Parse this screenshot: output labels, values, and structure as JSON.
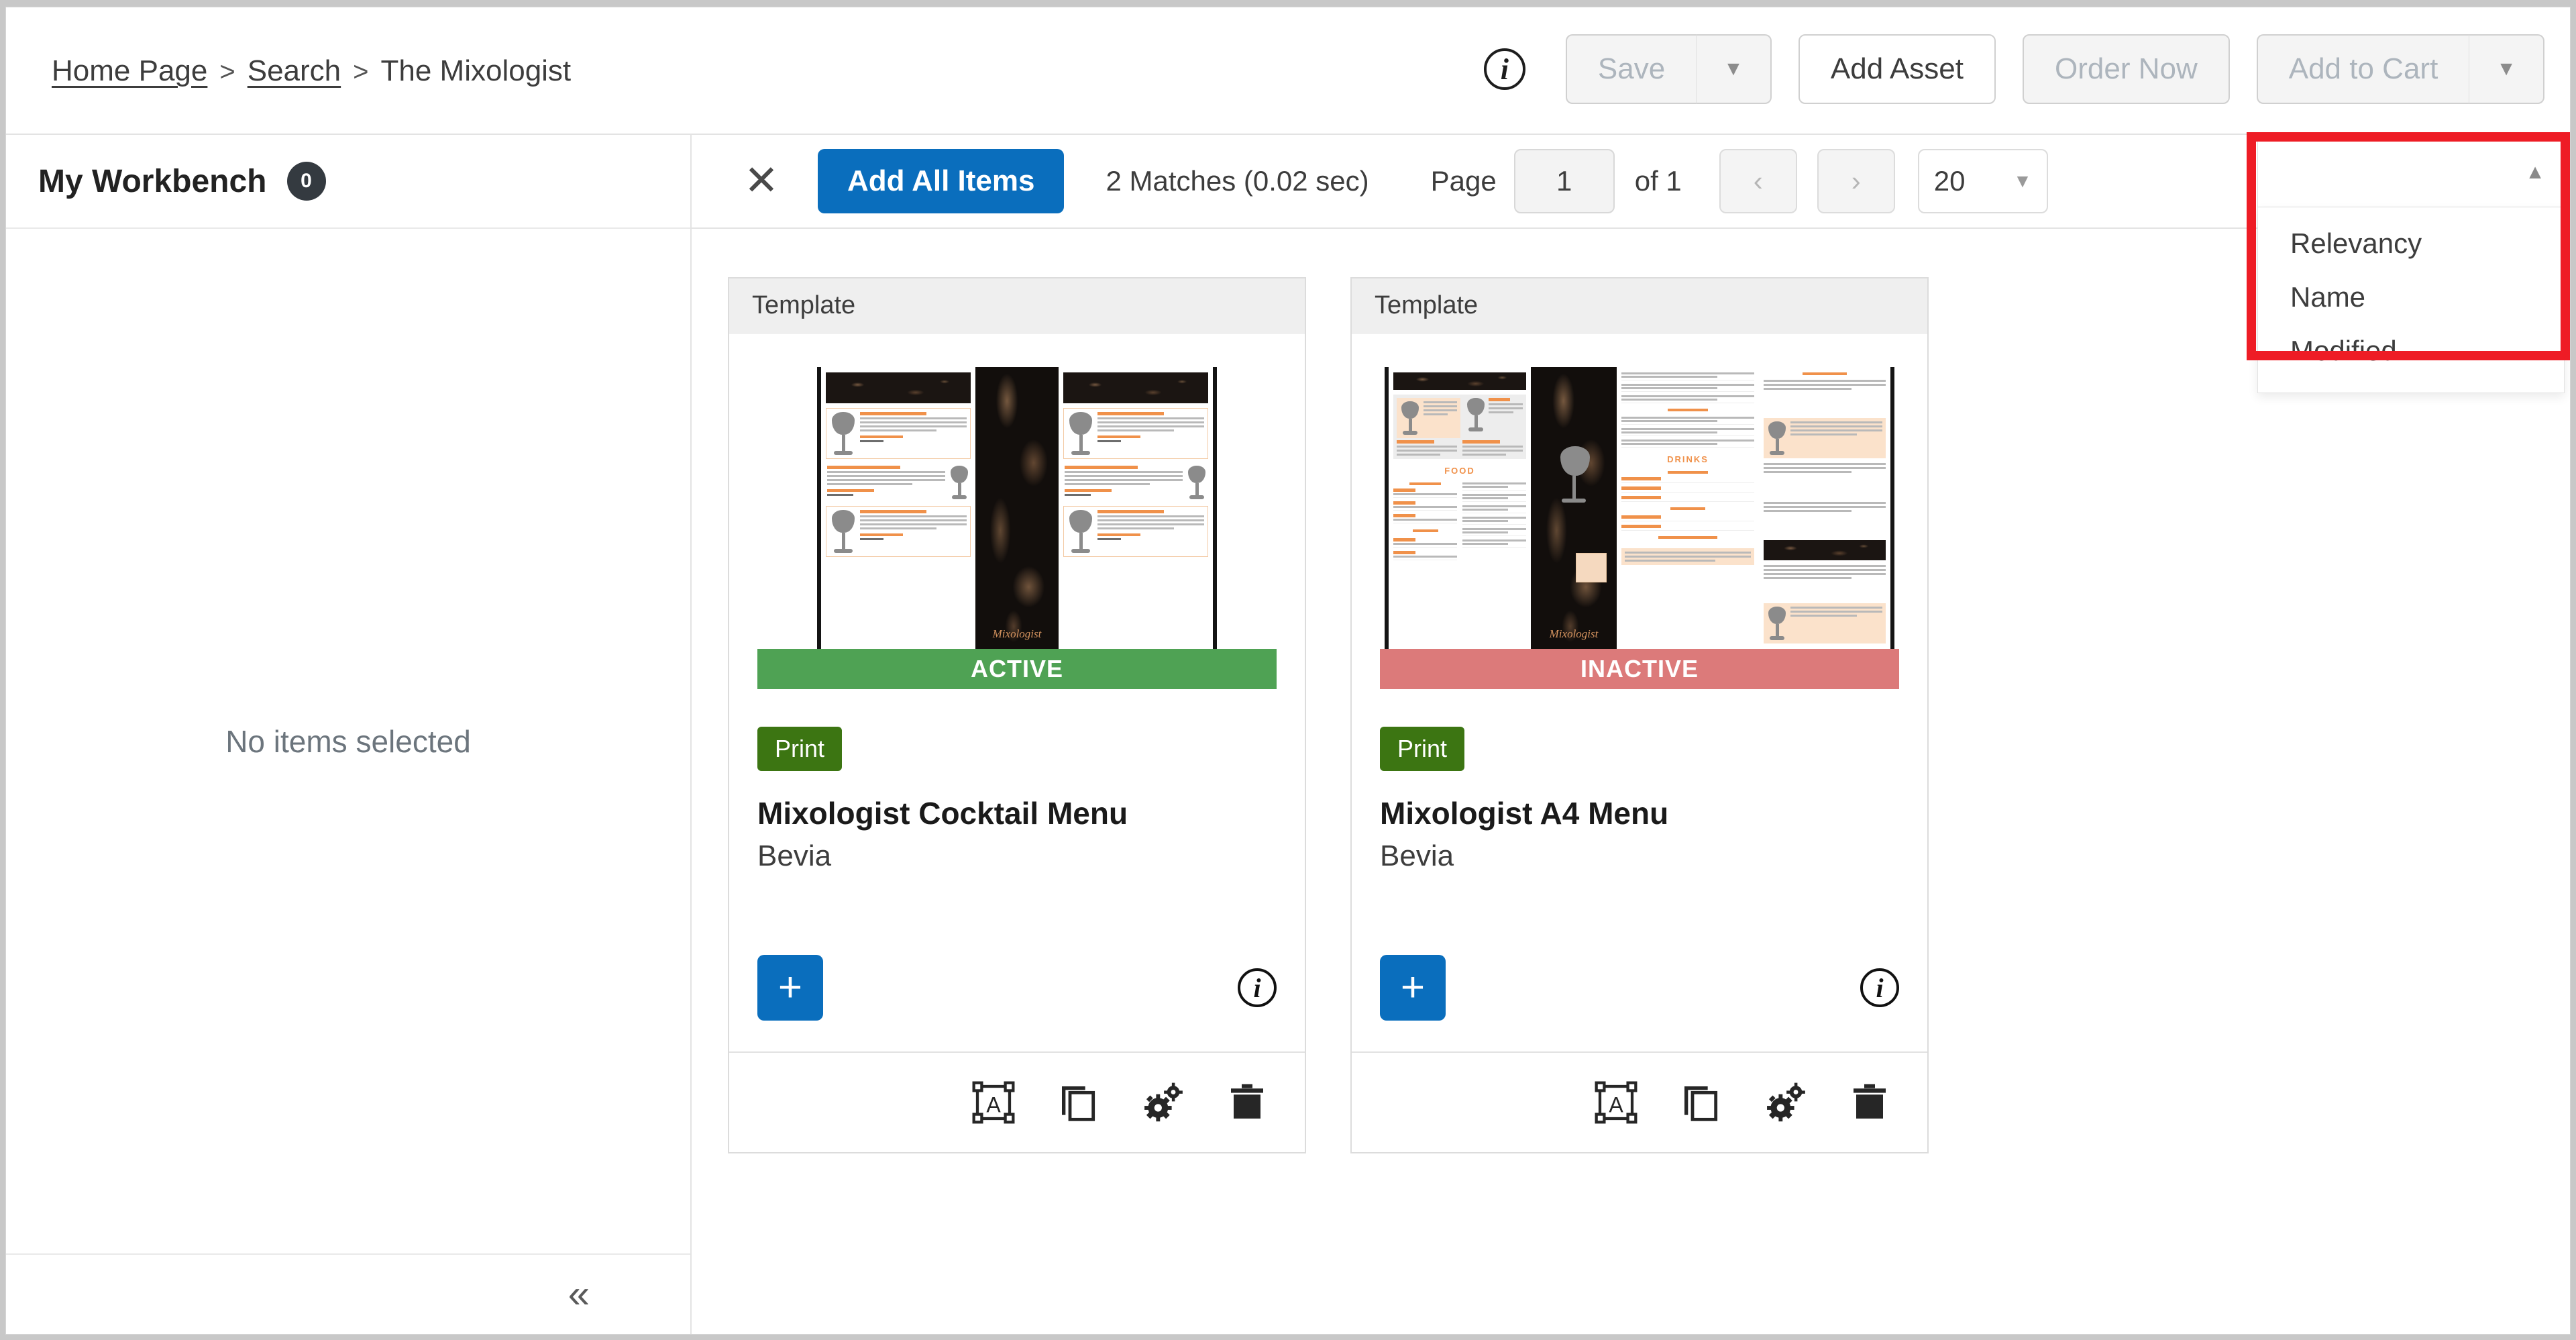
{
  "header": {
    "breadcrumb": [
      {
        "label": "Home Page",
        "link": true
      },
      {
        "label": "Search",
        "link": true
      },
      {
        "label": "The Mixologist",
        "link": false
      }
    ],
    "separator": ">",
    "info_icon": "i",
    "buttons": {
      "save": "Save",
      "save_caret": "▼",
      "add_asset": "Add Asset",
      "order_now": "Order Now",
      "add_to_cart": "Add to Cart",
      "cart_caret": "▼"
    }
  },
  "sidebar": {
    "title": "My Workbench",
    "badge_count": "0",
    "empty_message": "No items selected",
    "collapse_icon": "«"
  },
  "toolbar": {
    "close_icon": "✕",
    "add_all_items": "Add All Items",
    "matches": "2 Matches (0.02 sec)",
    "page_label": "Page",
    "page_value": "1",
    "page_of": "of 1",
    "prev_icon": "‹",
    "next_icon": "›",
    "page_size": "20",
    "page_size_caret": "▼"
  },
  "sort_dropdown": {
    "selected": "",
    "caret": "▲",
    "options": [
      "Relevancy",
      "Name",
      "Modified"
    ],
    "highlight_color": "#ee1c25"
  },
  "results": {
    "cards": [
      {
        "type_label": "Template",
        "status": "ACTIVE",
        "status_color": "#4fa254",
        "tag": "Print",
        "title": "Mixologist Cocktail Menu",
        "subtitle": "Bevia",
        "add_icon": "+",
        "info_icon": "i",
        "thumb_kind": "cocktail-spread"
      },
      {
        "type_label": "Template",
        "status": "INACTIVE",
        "status_color": "#dc7a7a",
        "tag": "Print",
        "title": "Mixologist A4 Menu",
        "subtitle": "Bevia",
        "add_icon": "+",
        "info_icon": "i",
        "thumb_kind": "a4-menu"
      }
    ],
    "footer_icons": [
      "edit-text-icon",
      "duplicate-icon",
      "settings-gears-icon",
      "delete-trash-icon"
    ]
  },
  "thumbnail_art": {
    "section_food": "FOOD",
    "section_drinks": "DRINKS",
    "signature": "Mixologist"
  },
  "colors": {
    "primary_blue": "#0a6ebd",
    "print_green": "#3c7512",
    "accent_orange": "#f0914a"
  }
}
